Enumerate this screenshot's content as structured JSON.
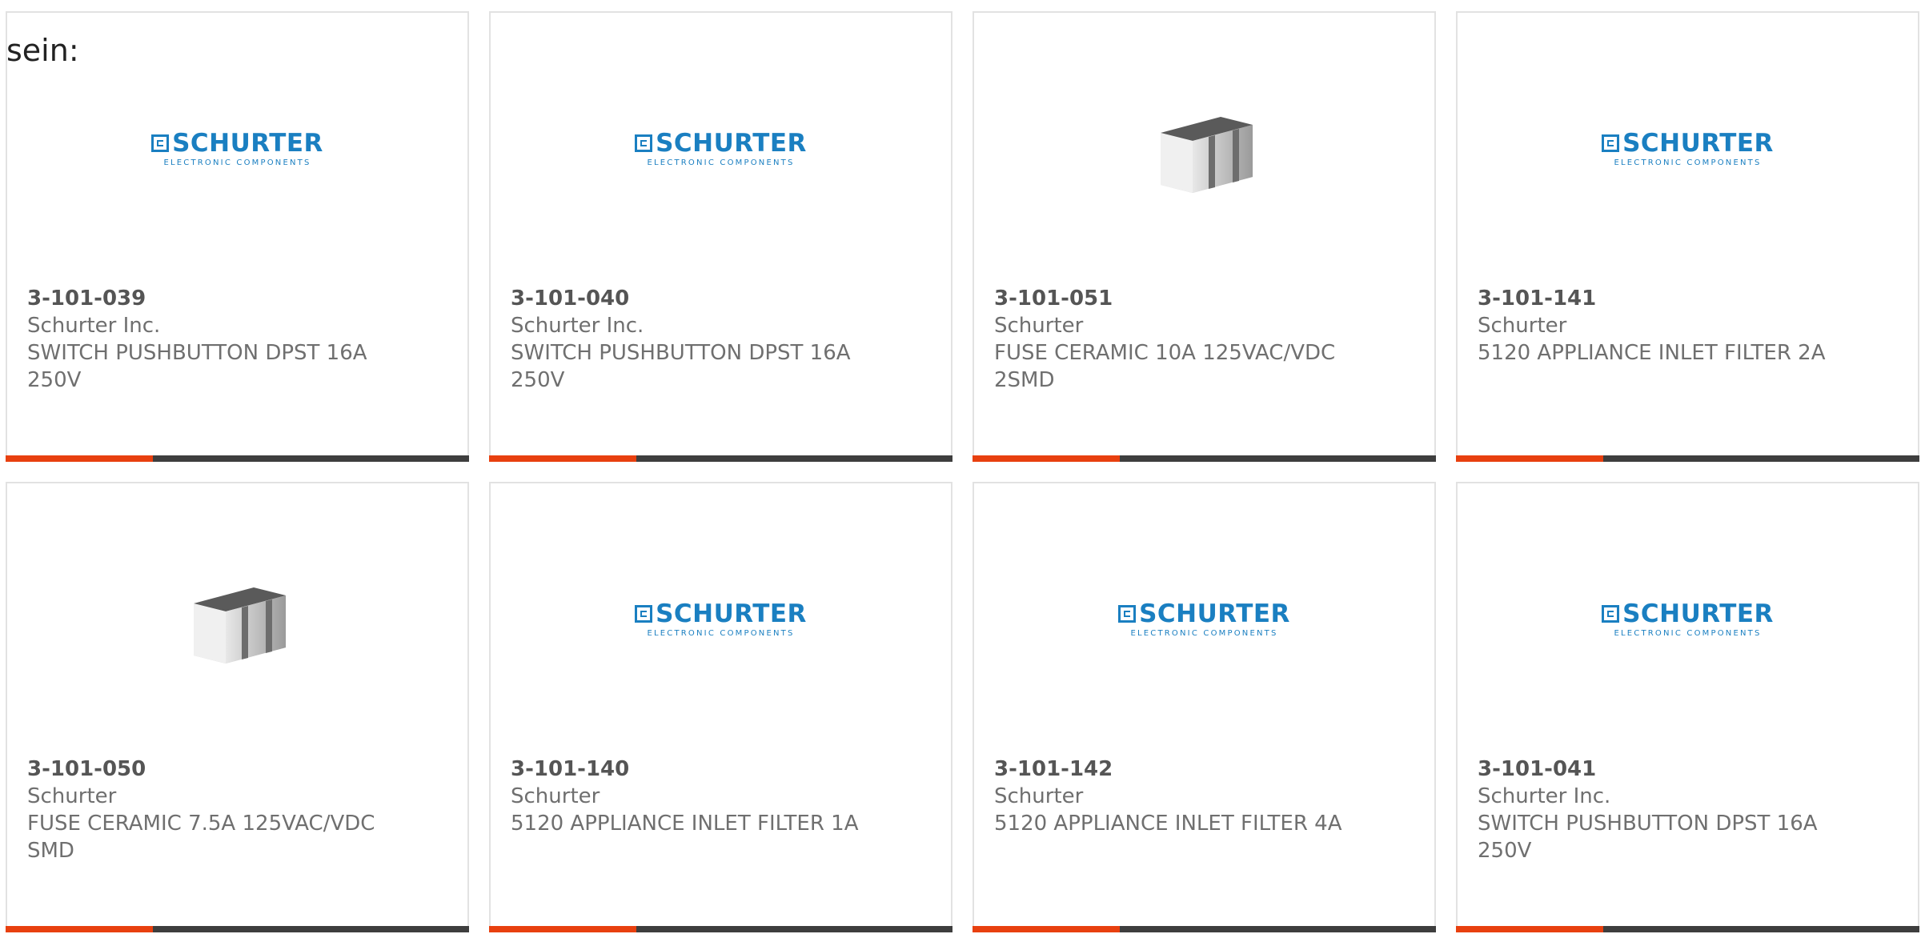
{
  "intro_text": "sein:",
  "logo": {
    "brand": "SCHURTER",
    "tagline": "ELECTRONIC COMPONENTS"
  },
  "colors": {
    "accent": "#e8400f",
    "bar": "#3e3e3e",
    "logo_blue": "#1a7fc1",
    "text": "#6f6f6f"
  },
  "products": [
    {
      "part_number": "3-101-039",
      "manufacturer": "Schurter Inc.",
      "description": "SWITCH PUSHBUTTON DPST 16A 250V",
      "image": "schurter-logo"
    },
    {
      "part_number": "3-101-040",
      "manufacturer": "Schurter Inc.",
      "description": "SWITCH PUSHBUTTON DPST 16A 250V",
      "image": "schurter-logo"
    },
    {
      "part_number": "3-101-051",
      "manufacturer": "Schurter",
      "description": "FUSE CERAMIC 10A 125VAC/VDC 2SMD",
      "image": "ceramic-fuse-photo"
    },
    {
      "part_number": "3-101-141",
      "manufacturer": "Schurter",
      "description": "5120 APPLIANCE INLET FILTER 2A",
      "image": "schurter-logo"
    },
    {
      "part_number": "3-101-050",
      "manufacturer": "Schurter",
      "description": "FUSE CERAMIC 7.5A 125VAC/VDC SMD",
      "image": "ceramic-fuse-photo"
    },
    {
      "part_number": "3-101-140",
      "manufacturer": "Schurter",
      "description": "5120 APPLIANCE INLET FILTER 1A",
      "image": "schurter-logo"
    },
    {
      "part_number": "3-101-142",
      "manufacturer": "Schurter",
      "description": "5120 APPLIANCE INLET FILTER 4A",
      "image": "schurter-logo"
    },
    {
      "part_number": "3-101-041",
      "manufacturer": "Schurter Inc.",
      "description": "SWITCH PUSHBUTTON DPST 16A 250V",
      "image": "schurter-logo"
    }
  ]
}
